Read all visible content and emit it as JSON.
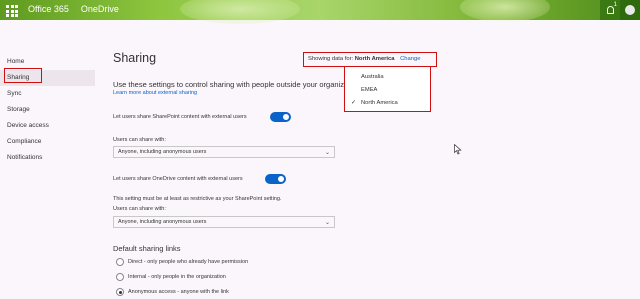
{
  "app": {
    "suite": "Office 365",
    "product": "OneDrive",
    "notification_count": "1"
  },
  "sidebar": {
    "items": [
      {
        "label": "Home"
      },
      {
        "label": "Sharing"
      },
      {
        "label": "Sync"
      },
      {
        "label": "Storage"
      },
      {
        "label": "Device access"
      },
      {
        "label": "Compliance"
      },
      {
        "label": "Notifications"
      }
    ],
    "selected": "Sharing"
  },
  "main": {
    "title": "Sharing",
    "intro": "Use these settings to control sharing with people outside your organization.",
    "learn_more": "Learn more about external sharing",
    "sharepoint_toggle_label": "Let users share SharePoint content with external users",
    "sharepoint_toggle_on": true,
    "sharepoint_select_label": "Users can share with:",
    "sharepoint_select_value": "Anyone, including anonymous users",
    "onedrive_toggle_label": "Let users share OneDrive content with external users",
    "onedrive_toggle_on": true,
    "onedrive_note": "This setting must be at least as restrictive as your SharePoint setting.",
    "onedrive_select_label": "Users can share with:",
    "onedrive_select_value": "Anyone, including anonymous users",
    "default_links_title": "Default sharing links",
    "links": [
      {
        "label": "Direct - only people who already have permission",
        "checked": false
      },
      {
        "label": "Internal - only people in the organization",
        "checked": false
      },
      {
        "label": "Anonymous access - anyone with the link",
        "checked": true
      }
    ]
  },
  "region": {
    "prefix": "Showing data for:",
    "current": "North America",
    "change_label": "Change",
    "options": [
      "Australia",
      "EMEA",
      "North America"
    ],
    "selected": "North America"
  },
  "colors": {
    "accent": "#0a63c9",
    "highlight": "#d01010",
    "topbar": "#7fb636"
  }
}
